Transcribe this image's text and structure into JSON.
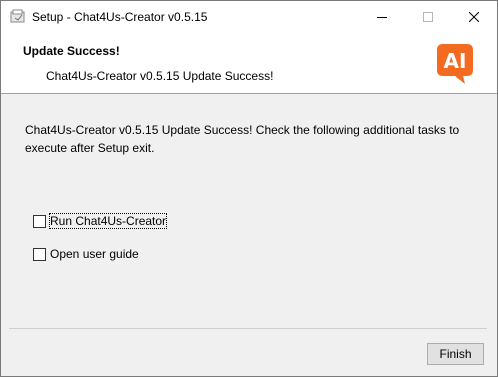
{
  "window": {
    "title": "Setup - Chat4Us-Creator v0.5.15"
  },
  "header": {
    "title": "Update Success!",
    "subtitle": "Chat4Us-Creator v0.5.15 Update Success!",
    "logo_text": "AI"
  },
  "body": {
    "message": "Chat4Us-Creator v0.5.15 Update Success! Check the following additional tasks to execute after Setup exit."
  },
  "tasks": [
    {
      "label": "Run Chat4Us-Creator",
      "checked": false
    },
    {
      "label": "Open user guide",
      "checked": false
    }
  ],
  "buttons": {
    "finish": "Finish"
  },
  "colors": {
    "logo_orange": "#f36b21",
    "header_bg": "#ffffff",
    "body_bg": "#f0f0f0"
  },
  "icons": {
    "app": "installer-icon",
    "minimize": "minimize-icon",
    "maximize": "maximize-icon",
    "close": "close-icon"
  }
}
